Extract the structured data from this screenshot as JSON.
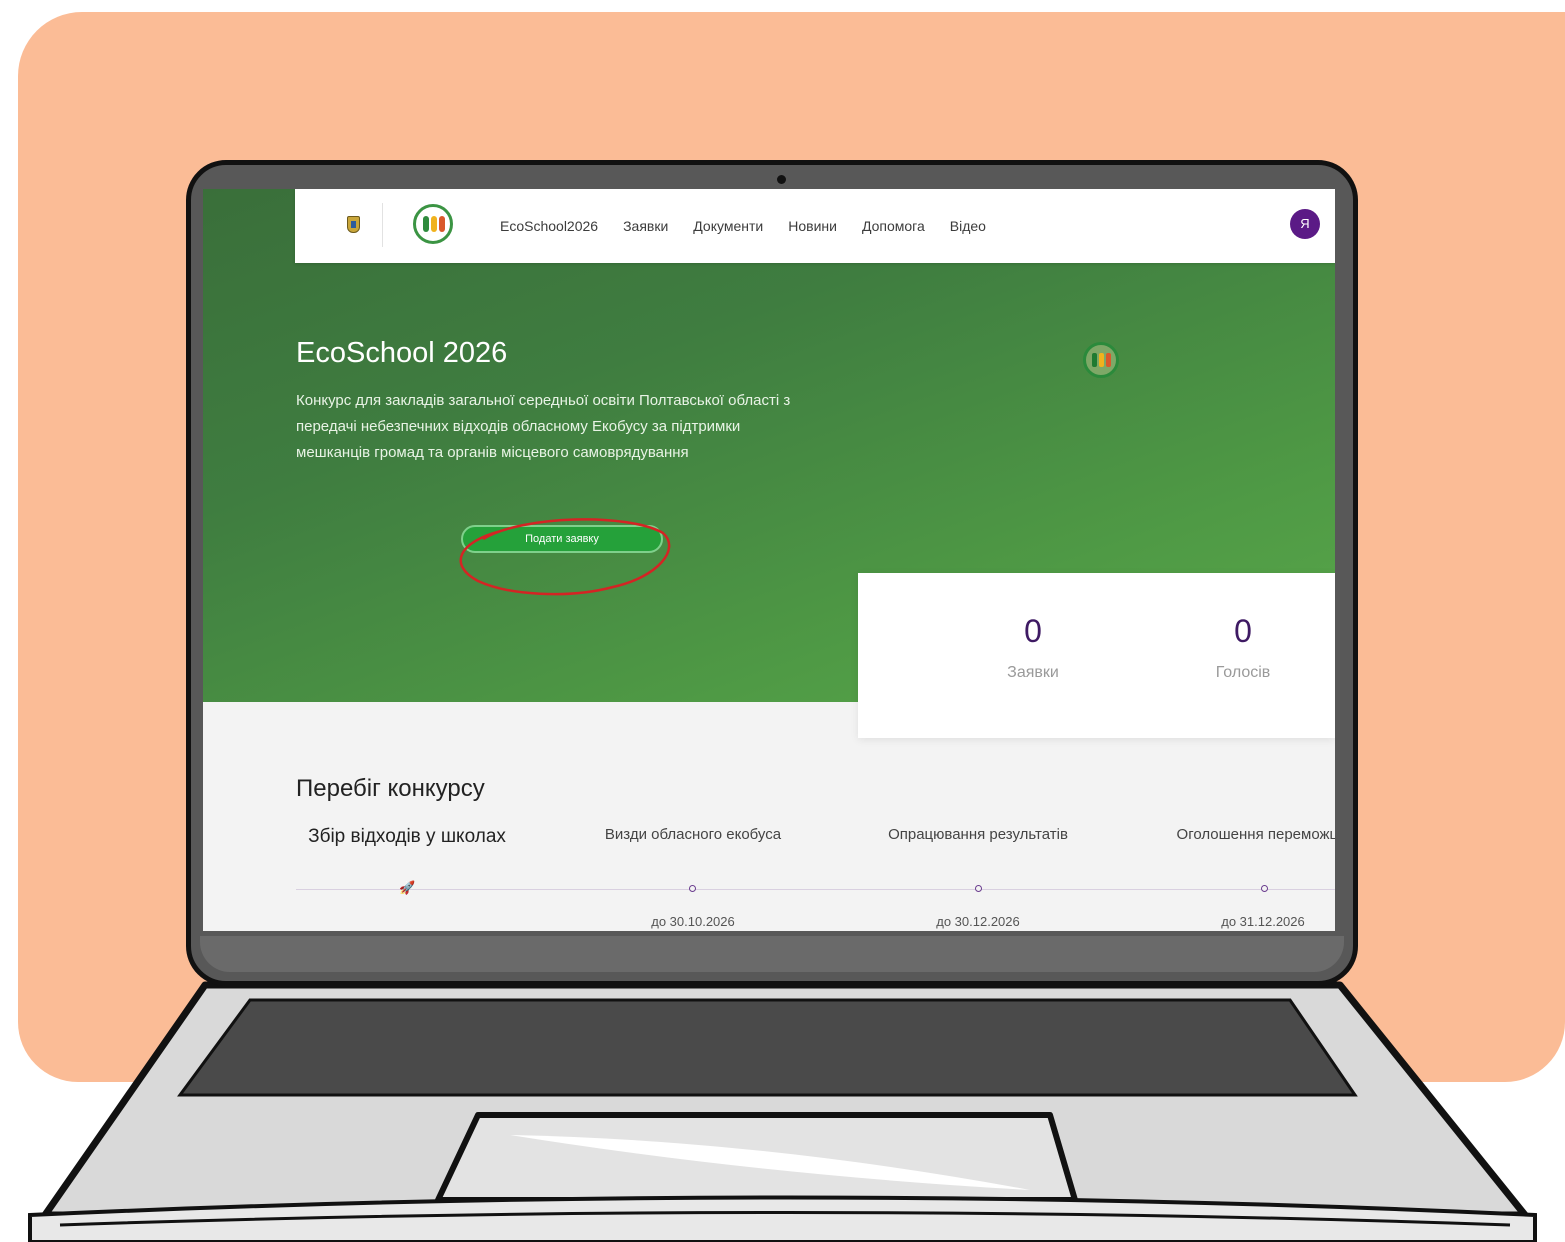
{
  "nav": {
    "items": [
      "EcoSchool2026",
      "Заявки",
      "Документи",
      "Новини",
      "Допомога",
      "Відео"
    ],
    "avatar_initial": "Я"
  },
  "hero": {
    "title": "EcoSchool 2026",
    "description": "Конкурс для закладів загальної середньої освіти Полтавської області з передачі небезпечних відходів обласному Екобусу за підтримки мешканців громад та органів місцевого самоврядування",
    "apply_button": "Подати заявку"
  },
  "stats": [
    {
      "value": "0",
      "label": "Заявки"
    },
    {
      "value": "0",
      "label": "Голосів"
    }
  ],
  "progress": {
    "title": "Перебіг конкурсу",
    "stages": [
      {
        "label": "Збір відходів у школах",
        "date": ""
      },
      {
        "label": "Визди обласного екобуса",
        "date": "до 30.10.2026"
      },
      {
        "label": "Опрацювання результатів",
        "date": "до 30.12.2026"
      },
      {
        "label": "Оголошення переможців",
        "date": "до 31.12.2026"
      }
    ]
  },
  "colors": {
    "background_card": "#fbbc96",
    "hero_green": "#4f9a45",
    "button_green": "#25a13a",
    "accent_purple": "#5b1a86",
    "annotation_red": "#d42424"
  },
  "icons": [
    "oblast-crest-icon",
    "ecoschool-logo-icon",
    "user-avatar-icon",
    "rocket-icon",
    "timeline-dot-icon"
  ]
}
